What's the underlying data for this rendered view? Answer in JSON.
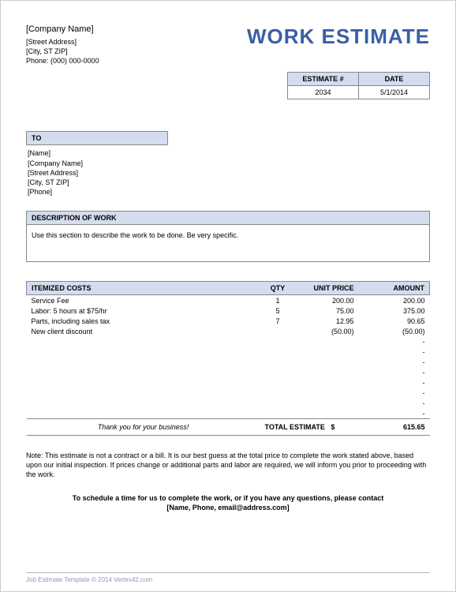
{
  "title": "WORK ESTIMATE",
  "company": {
    "name": "[Company Name]",
    "street": "[Street Address]",
    "city": "[City, ST  ZIP]",
    "phone": "Phone: (000) 000-0000"
  },
  "meta": {
    "estimate_label": "ESTIMATE #",
    "date_label": "DATE",
    "estimate_no": "2034",
    "date": "5/1/2014"
  },
  "to": {
    "header": "TO",
    "name": "[Name]",
    "company": "[Company Name]",
    "street": "[Street Address]",
    "city": "[City, ST  ZIP]",
    "phone": "[Phone]"
  },
  "desc": {
    "header": "DESCRIPTION OF WORK",
    "text": "Use this section to describe the work to be done. Be very specific."
  },
  "items": {
    "headers": {
      "desc": "ITEMIZED COSTS",
      "qty": "QTY",
      "price": "UNIT PRICE",
      "amount": "AMOUNT"
    },
    "rows": [
      {
        "desc": "Service Fee",
        "qty": "1",
        "price": "200.00",
        "amount": "200.00"
      },
      {
        "desc": "Labor: 5 hours at $75/hr",
        "qty": "5",
        "price": "75.00",
        "amount": "375.00"
      },
      {
        "desc": "Parts, including sales tax",
        "qty": "7",
        "price": "12.95",
        "amount": "90.65"
      },
      {
        "desc": "New client discount",
        "qty": "",
        "price": "(50.00)",
        "amount": "(50.00)"
      },
      {
        "desc": "",
        "qty": "",
        "price": "",
        "amount": "-"
      },
      {
        "desc": "",
        "qty": "",
        "price": "",
        "amount": "-"
      },
      {
        "desc": "",
        "qty": "",
        "price": "",
        "amount": "-"
      },
      {
        "desc": "",
        "qty": "",
        "price": "",
        "amount": "-"
      },
      {
        "desc": "",
        "qty": "",
        "price": "",
        "amount": "-"
      },
      {
        "desc": "",
        "qty": "",
        "price": "",
        "amount": "-"
      },
      {
        "desc": "",
        "qty": "",
        "price": "",
        "amount": "-"
      },
      {
        "desc": "",
        "qty": "",
        "price": "",
        "amount": "-"
      }
    ]
  },
  "totals": {
    "thank": "Thank you for your business!",
    "label": "TOTAL ESTIMATE",
    "currency": "$",
    "amount": "615.65"
  },
  "note": "Note: This estimate is not a contract or a bill. It is our best guess at the total price to complete the work stated above, based upon our initial inspection. If prices change or additional parts and labor are required, we will inform you prior to proceeding with the work.",
  "contact": {
    "line1": "To schedule a time for us to complete the work, or if you have any questions, please contact",
    "line2": "[Name, Phone, email@address.com]"
  },
  "footer": "Job Estimate Template © 2014 Vertex42.com"
}
